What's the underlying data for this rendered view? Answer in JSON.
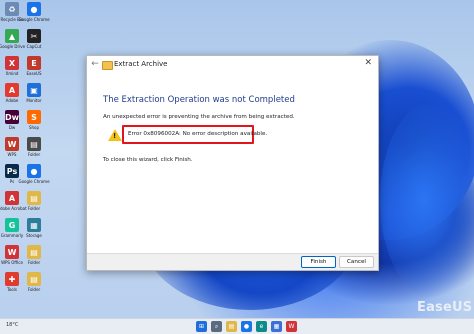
{
  "desktop": {
    "icons": [
      {
        "label": "Recycle Bin",
        "glyph": "♻",
        "color": "#6b8bb5"
      },
      {
        "label": "Google Chrome",
        "glyph": "●",
        "color": "#1a73e8"
      },
      {
        "label": "Google Drive",
        "glyph": "▲",
        "color": "#34a853"
      },
      {
        "label": "CapCut",
        "glyph": "✂",
        "color": "#222222"
      },
      {
        "label": "Xmind",
        "glyph": "X",
        "color": "#d13438"
      },
      {
        "label": "EaseUS",
        "glyph": "E",
        "color": "#c0392b"
      },
      {
        "label": "Adobe",
        "glyph": "A",
        "color": "#e23b2e"
      },
      {
        "label": "Monitor",
        "glyph": "▣",
        "color": "#1e6fd9"
      },
      {
        "label": "Dw",
        "glyph": "Dw",
        "color": "#470137"
      },
      {
        "label": "Shop",
        "glyph": "S",
        "color": "#ff6a00"
      },
      {
        "label": "WPS",
        "glyph": "W",
        "color": "#c0392b"
      },
      {
        "label": "Folder",
        "glyph": "▤",
        "color": "#4a4a4a"
      },
      {
        "label": "Ps",
        "glyph": "Ps",
        "color": "#0a2a4a"
      },
      {
        "label": "Google Chrome",
        "glyph": "●",
        "color": "#1a73e8"
      },
      {
        "label": "Adobe Acrobat",
        "glyph": "A",
        "color": "#d13438"
      },
      {
        "label": "Folder",
        "glyph": "▤",
        "color": "#e0b84a"
      },
      {
        "label": "Grammarly",
        "glyph": "G",
        "color": "#15c39a"
      },
      {
        "label": "Storage",
        "glyph": "▦",
        "color": "#2d7d9a"
      },
      {
        "label": "WPS Office",
        "glyph": "W",
        "color": "#d13438"
      },
      {
        "label": "Folder",
        "glyph": "▤",
        "color": "#e0b84a"
      },
      {
        "label": "Tools",
        "glyph": "✚",
        "color": "#e23b2e"
      },
      {
        "label": "Folder",
        "glyph": "▤",
        "color": "#e0b84a"
      }
    ]
  },
  "dialog": {
    "title": "Extract Archive",
    "heading": "The Extraction Operation was not Completed",
    "description": "An unexpected error is preventing the archive from being extracted.",
    "error_text": "Error 0x8096002A: No error description available.",
    "close_info": "To close this wizard, click Finish.",
    "finish_label": "Finish",
    "cancel_label": "Cancel",
    "close_glyph": "✕",
    "back_glyph": "←"
  },
  "taskbar": {
    "weather": "18°C",
    "apps": [
      {
        "name": "start-icon",
        "glyph": "⊞",
        "color": "#1e6fd9"
      },
      {
        "name": "search-icon",
        "glyph": "⌕",
        "color": "#5a6b80"
      },
      {
        "name": "explorer-icon",
        "glyph": "▤",
        "color": "#e0b84a"
      },
      {
        "name": "chrome-icon",
        "glyph": "●",
        "color": "#1a73e8"
      },
      {
        "name": "edge-icon",
        "glyph": "e",
        "color": "#0f8a8a"
      },
      {
        "name": "store-icon",
        "glyph": "▦",
        "color": "#3a6fd8"
      },
      {
        "name": "wps-icon",
        "glyph": "W",
        "color": "#d13438"
      }
    ]
  },
  "watermark": "EaseUS"
}
